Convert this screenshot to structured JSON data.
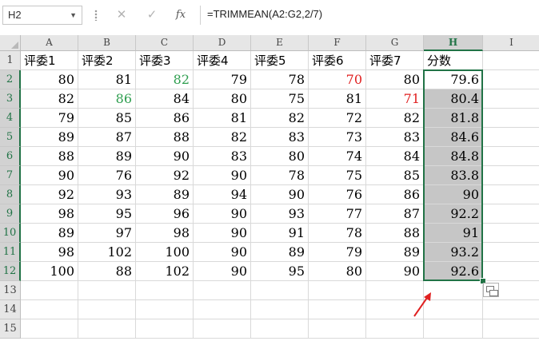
{
  "name_box": "H2",
  "formula": "=TRIMMEAN(A2:G2,2/7)",
  "formula_buttons": {
    "cancel": "✕",
    "enter": "✓",
    "fx": "fx"
  },
  "columns": [
    "A",
    "B",
    "C",
    "D",
    "E",
    "F",
    "G",
    "H",
    "I"
  ],
  "rows": [
    "1",
    "2",
    "3",
    "4",
    "5",
    "6",
    "7",
    "8",
    "9",
    "10",
    "11",
    "12",
    "13",
    "14",
    "15"
  ],
  "headers": [
    "评委1",
    "评委2",
    "评委3",
    "评委4",
    "评委5",
    "评委6",
    "评委7",
    "分数"
  ],
  "table": [
    [
      "80",
      "81",
      "82",
      "79",
      "78",
      "70",
      "80",
      "79.6"
    ],
    [
      "82",
      "86",
      "84",
      "80",
      "75",
      "81",
      "71",
      "80.4"
    ],
    [
      "79",
      "85",
      "86",
      "81",
      "82",
      "72",
      "82",
      "81.8"
    ],
    [
      "89",
      "87",
      "88",
      "82",
      "83",
      "73",
      "83",
      "84.6"
    ],
    [
      "88",
      "89",
      "90",
      "83",
      "80",
      "74",
      "84",
      "84.8"
    ],
    [
      "90",
      "76",
      "92",
      "90",
      "78",
      "75",
      "85",
      "83.8"
    ],
    [
      "92",
      "93",
      "89",
      "94",
      "90",
      "76",
      "86",
      "90"
    ],
    [
      "98",
      "95",
      "96",
      "90",
      "93",
      "77",
      "87",
      "92.2"
    ],
    [
      "89",
      "97",
      "98",
      "90",
      "91",
      "78",
      "88",
      "91"
    ],
    [
      "98",
      "102",
      "100",
      "90",
      "89",
      "79",
      "89",
      "93.2"
    ],
    [
      "100",
      "88",
      "102",
      "90",
      "95",
      "80",
      "90",
      "92.6"
    ]
  ],
  "colored_cells": [
    {
      "row": 0,
      "col": 2,
      "color": "#2e9e4f"
    },
    {
      "row": 0,
      "col": 5,
      "color": "#e02020"
    },
    {
      "row": 1,
      "col": 1,
      "color": "#2e9e4f"
    },
    {
      "row": 1,
      "col": 6,
      "color": "#e02020"
    }
  ],
  "accent_color": "#217346",
  "arrow_color": "#e02020"
}
